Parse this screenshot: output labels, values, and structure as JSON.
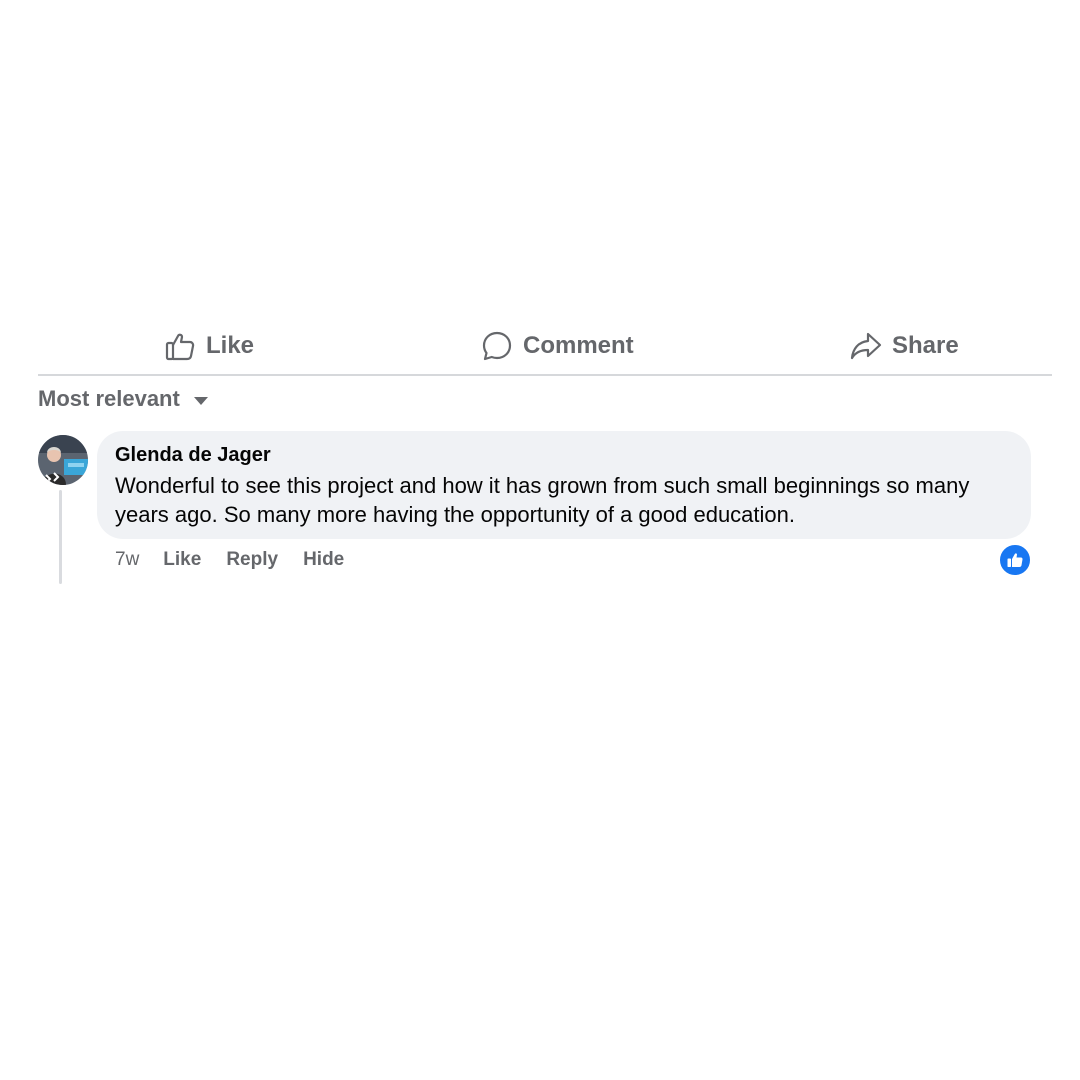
{
  "actions": {
    "like_label": "Like",
    "comment_label": "Comment",
    "share_label": "Share"
  },
  "sort": {
    "label": "Most relevant"
  },
  "comment": {
    "author": "Glenda de Jager",
    "text": "Wonderful to see this project and how it has grown from such small beginnings so many years ago. So many more having the opportunity of a good education.",
    "time": "7w",
    "like_label": "Like",
    "reply_label": "Reply",
    "hide_label": "Hide",
    "reaction_icon": "thumbs-up-icon"
  },
  "colors": {
    "muted_text": "#65676b",
    "bubble_bg": "#f0f2f5",
    "reaction_blue": "#1877f2"
  }
}
